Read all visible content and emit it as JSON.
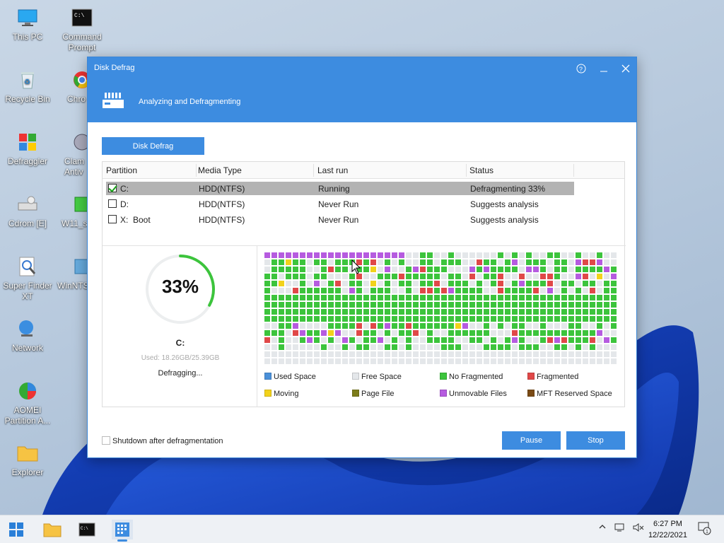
{
  "desktop": {
    "icons": [
      {
        "label": "This PC",
        "icon": "monitor-icon"
      },
      {
        "label": "Command Prompt",
        "icon": "cmd-icon"
      },
      {
        "label": "Recycle Bin",
        "icon": "recycle-bin-icon"
      },
      {
        "label": "Chro",
        "icon": "chrome-icon"
      },
      {
        "label": "Defraggler",
        "icon": "defraggler-icon"
      },
      {
        "label": "Clam Antiv",
        "icon": "clamav-icon"
      },
      {
        "label": "Cdrom [E]",
        "icon": "cdrom-icon"
      },
      {
        "label": "W11_s",
        "icon": "shortcut-icon"
      },
      {
        "label": "Super Finder XT",
        "icon": "magnifier-icon"
      },
      {
        "label": "WinNTS",
        "icon": "installer-icon"
      },
      {
        "label": "Network",
        "icon": "network-icon"
      },
      {
        "label": "AOMEI Partition A...",
        "icon": "aomei-icon"
      },
      {
        "label": "Explorer",
        "icon": "folder-icon"
      }
    ]
  },
  "window": {
    "title": "Disk Defrag",
    "subtitle": "Analyzing and Defragmenting",
    "tab": "Disk Defrag",
    "columns": [
      "Partition",
      "Media Type",
      "Last run",
      "Status"
    ],
    "rows": [
      {
        "checked": true,
        "partition": "C:",
        "media": "HDD(NTFS)",
        "last_run": "Running",
        "status": "Defragmenting 33%"
      },
      {
        "checked": false,
        "partition": "D:",
        "media": "HDD(NTFS)",
        "last_run": "Never Run",
        "status": "Suggests analysis"
      },
      {
        "checked": false,
        "partition": "X:  Boot",
        "media": "HDD(NTFS)",
        "last_run": "Never Run",
        "status": "Suggests analysis"
      }
    ],
    "progress": {
      "percent_label": "33%",
      "value": 0.33,
      "drive": "C:",
      "used": "Used: 18.26GB/25.39GB",
      "state": "Defragging..."
    },
    "legend": [
      {
        "label": "Used Space",
        "color": "#4a90d9"
      },
      {
        "label": "Free Space",
        "color": "#e4e7ea"
      },
      {
        "label": "No Fragmented",
        "color": "#3cc43c"
      },
      {
        "label": "Fragmented",
        "color": "#e04848"
      },
      {
        "label": "Moving",
        "color": "#f2d21b"
      },
      {
        "label": "Page File",
        "color": "#7c7c1a"
      },
      {
        "label": "Unmovable Files",
        "color": "#b65be0"
      },
      {
        "label": "MFT Reserved Space",
        "color": "#7a4a14"
      }
    ],
    "shutdown_label": "Shutdown after defragmentation",
    "pause": "Pause",
    "stop": "Stop"
  },
  "taskbar": {
    "time": "6:27 PM",
    "date": "12/22/2021",
    "notification_count": "1"
  }
}
